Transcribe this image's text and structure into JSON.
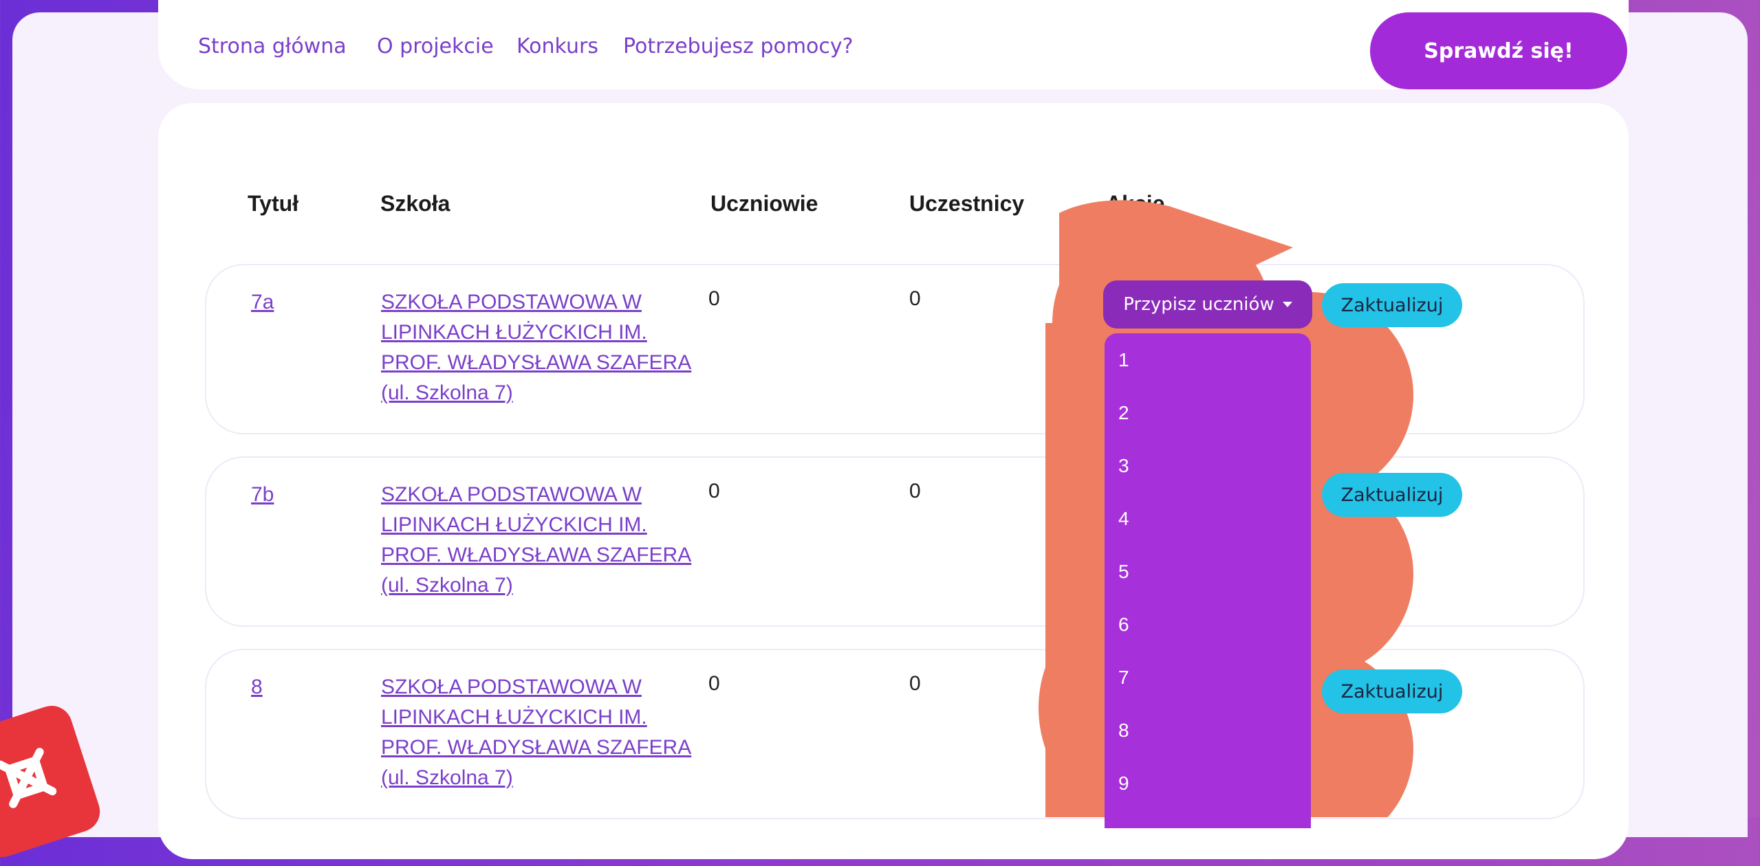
{
  "nav": {
    "links": [
      "Strona główna",
      "O projekcie",
      "Konkurs",
      "Potrzebujesz pomocy?"
    ],
    "cta": "Sprawdź się!"
  },
  "table": {
    "headers": [
      "Tytuł",
      "Szkoła",
      "Uczniowie",
      "Uczestnicy",
      "Akcje"
    ],
    "rows": [
      {
        "title": "7a",
        "school": [
          "SZKOŁA PODSTAWOWA W",
          "LIPINKACH ŁUŻYCKICH IM.",
          "PROF. WŁADYSŁAWA SZAFERA",
          "(ul. Szkolna 7)"
        ],
        "students": "0",
        "participants": "0"
      },
      {
        "title": "7b",
        "school": [
          "SZKOŁA PODSTAWOWA W",
          "LIPINKACH ŁUŻYCKICH IM.",
          "PROF. WŁADYSŁAWA SZAFERA",
          "(ul. Szkolna 7)"
        ],
        "students": "0",
        "participants": "0"
      },
      {
        "title": "8",
        "school": [
          "SZKOŁA PODSTAWOWA W",
          "LIPINKACH ŁUŻYCKICH IM.",
          "PROF. WŁADYSŁAWA SZAFERA",
          "(ul. Szkolna 7)"
        ],
        "students": "0",
        "participants": "0"
      }
    ]
  },
  "actions": {
    "assign_label": "Przypisz uczniów",
    "update_label": "Zaktualizuj",
    "dropdown_options": [
      "1",
      "2",
      "3",
      "4",
      "5",
      "6",
      "7",
      "8",
      "9"
    ]
  },
  "colors": {
    "accent": "#a32ad8",
    "link": "#7a3fc9",
    "update_button": "#22c3e6",
    "highlight_blob": "#ef7d62"
  },
  "icons": [
    "close-icon"
  ]
}
